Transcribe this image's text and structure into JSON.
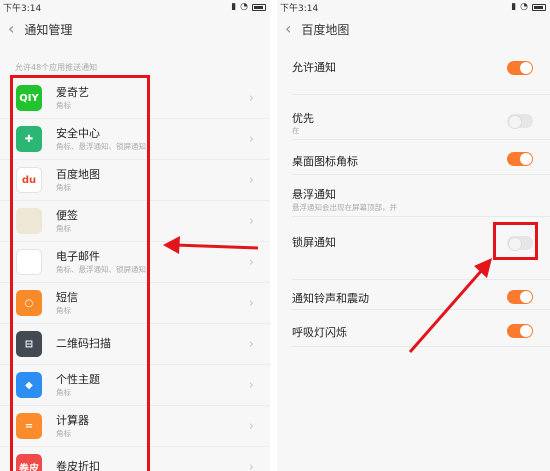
{
  "left_screen": {
    "status_bar": {
      "time": "下午3:14"
    },
    "title": "通知管理",
    "section_hint": "允许48个应用推送通知",
    "apps": [
      {
        "name": "爱奇艺",
        "sub": "角标",
        "icon": "iqiyi-icon",
        "color": "#22c32e",
        "glyph": "QIY"
      },
      {
        "name": "安全中心",
        "sub": "角标、悬浮通知、锁屏通知",
        "icon": "security-center-icon",
        "color": "#2bb673",
        "glyph": "✚"
      },
      {
        "name": "百度地图",
        "sub": "角标",
        "icon": "baidu-map-icon",
        "color": "#ffffff",
        "glyph": "du"
      },
      {
        "name": "便签",
        "sub": "角标",
        "icon": "notes-icon",
        "color": "#efe7d6",
        "glyph": ""
      },
      {
        "name": "电子邮件",
        "sub": "角标、悬浮通知、锁屏通知",
        "icon": "email-icon",
        "color": "#ffffff",
        "glyph": ""
      },
      {
        "name": "短信",
        "sub": "角标",
        "icon": "sms-icon",
        "color": "#f98a2a",
        "glyph": "○"
      },
      {
        "name": "二维码扫描",
        "sub": "",
        "icon": "qr-scanner-icon",
        "color": "#444a52",
        "glyph": "⊟"
      },
      {
        "name": "个性主题",
        "sub": "角标",
        "icon": "themes-icon",
        "color": "#2c8ef2",
        "glyph": "◆"
      },
      {
        "name": "计算器",
        "sub": "角标",
        "icon": "calculator-icon",
        "color": "#fb8c2c",
        "glyph": "="
      },
      {
        "name": "卷皮折扣",
        "sub": "",
        "icon": "juanpi-icon",
        "color": "#ef4b4b",
        "glyph": "卷皮"
      }
    ]
  },
  "right_screen": {
    "status_bar": {
      "time": "下午3:14"
    },
    "title": "百度地图",
    "settings": [
      {
        "label": "允许通知",
        "desc": "",
        "state": "on"
      },
      {
        "label": "优先",
        "desc": "在",
        "state": "off"
      },
      {
        "label": "桌面图标角标",
        "desc": "",
        "state": "on"
      },
      {
        "label": "悬浮通知",
        "desc": "悬浮通知会出现在屏幕顶部，并",
        "state": ""
      },
      {
        "label": "锁屏通知",
        "desc": "",
        "state": "off"
      },
      {
        "label": "通知铃声和震动",
        "desc": "",
        "state": "on"
      },
      {
        "label": "呼吸灯闪烁",
        "desc": "",
        "state": "on"
      }
    ]
  },
  "colors": {
    "accent_toggle": "#fb7a2f",
    "annotation_red": "#e4141b"
  }
}
